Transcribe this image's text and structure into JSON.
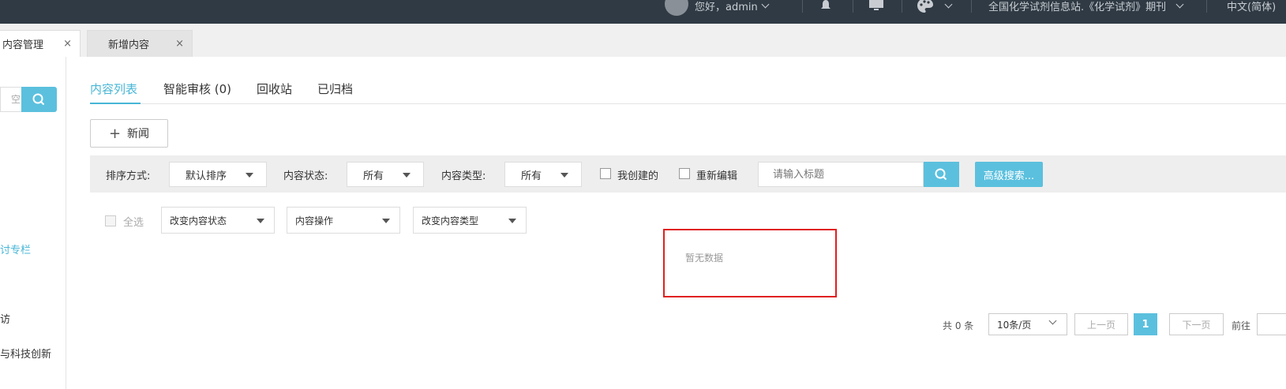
{
  "topbar": {
    "greeting": "您好，admin",
    "site": "全国化学试剂信息站.《化学试剂》期刊",
    "language": "中文(简体)"
  },
  "page_tabs": [
    {
      "label": "内容管理",
      "close": "×"
    },
    {
      "label": "新增内容",
      "close": "×"
    }
  ],
  "sidebar": {
    "search_placeholder": "空",
    "items": [
      "讨专栏",
      "访",
      "与科技创新"
    ]
  },
  "content_tabs": [
    "内容列表",
    "智能审核 (0)",
    "回收站",
    "已归档"
  ],
  "add_button": {
    "icon": "+",
    "label": "新闻"
  },
  "filters": {
    "sort_label": "排序方式:",
    "sort_value": "默认排序",
    "status_label": "内容状态:",
    "status_value": "所有",
    "type_label": "内容类型:",
    "type_value": "所有",
    "mine_label": "我创建的",
    "reedit_label": "重新编辑",
    "title_placeholder": "请输入标题",
    "advanced_label": "高级搜索..."
  },
  "actions": {
    "select_all": "全选",
    "change_status": "改变内容状态",
    "content_ops": "内容操作",
    "change_type": "改变内容类型"
  },
  "empty_text": "暂无数据",
  "pagination": {
    "total": "共 0 条",
    "page_size": "10条/页",
    "prev": "上一页",
    "current": "1",
    "next": "下一页",
    "goto": "前往"
  },
  "colors": {
    "accent": "#5bc0de",
    "topbar": "#2f3a44",
    "highlight_border": "#e02020"
  }
}
